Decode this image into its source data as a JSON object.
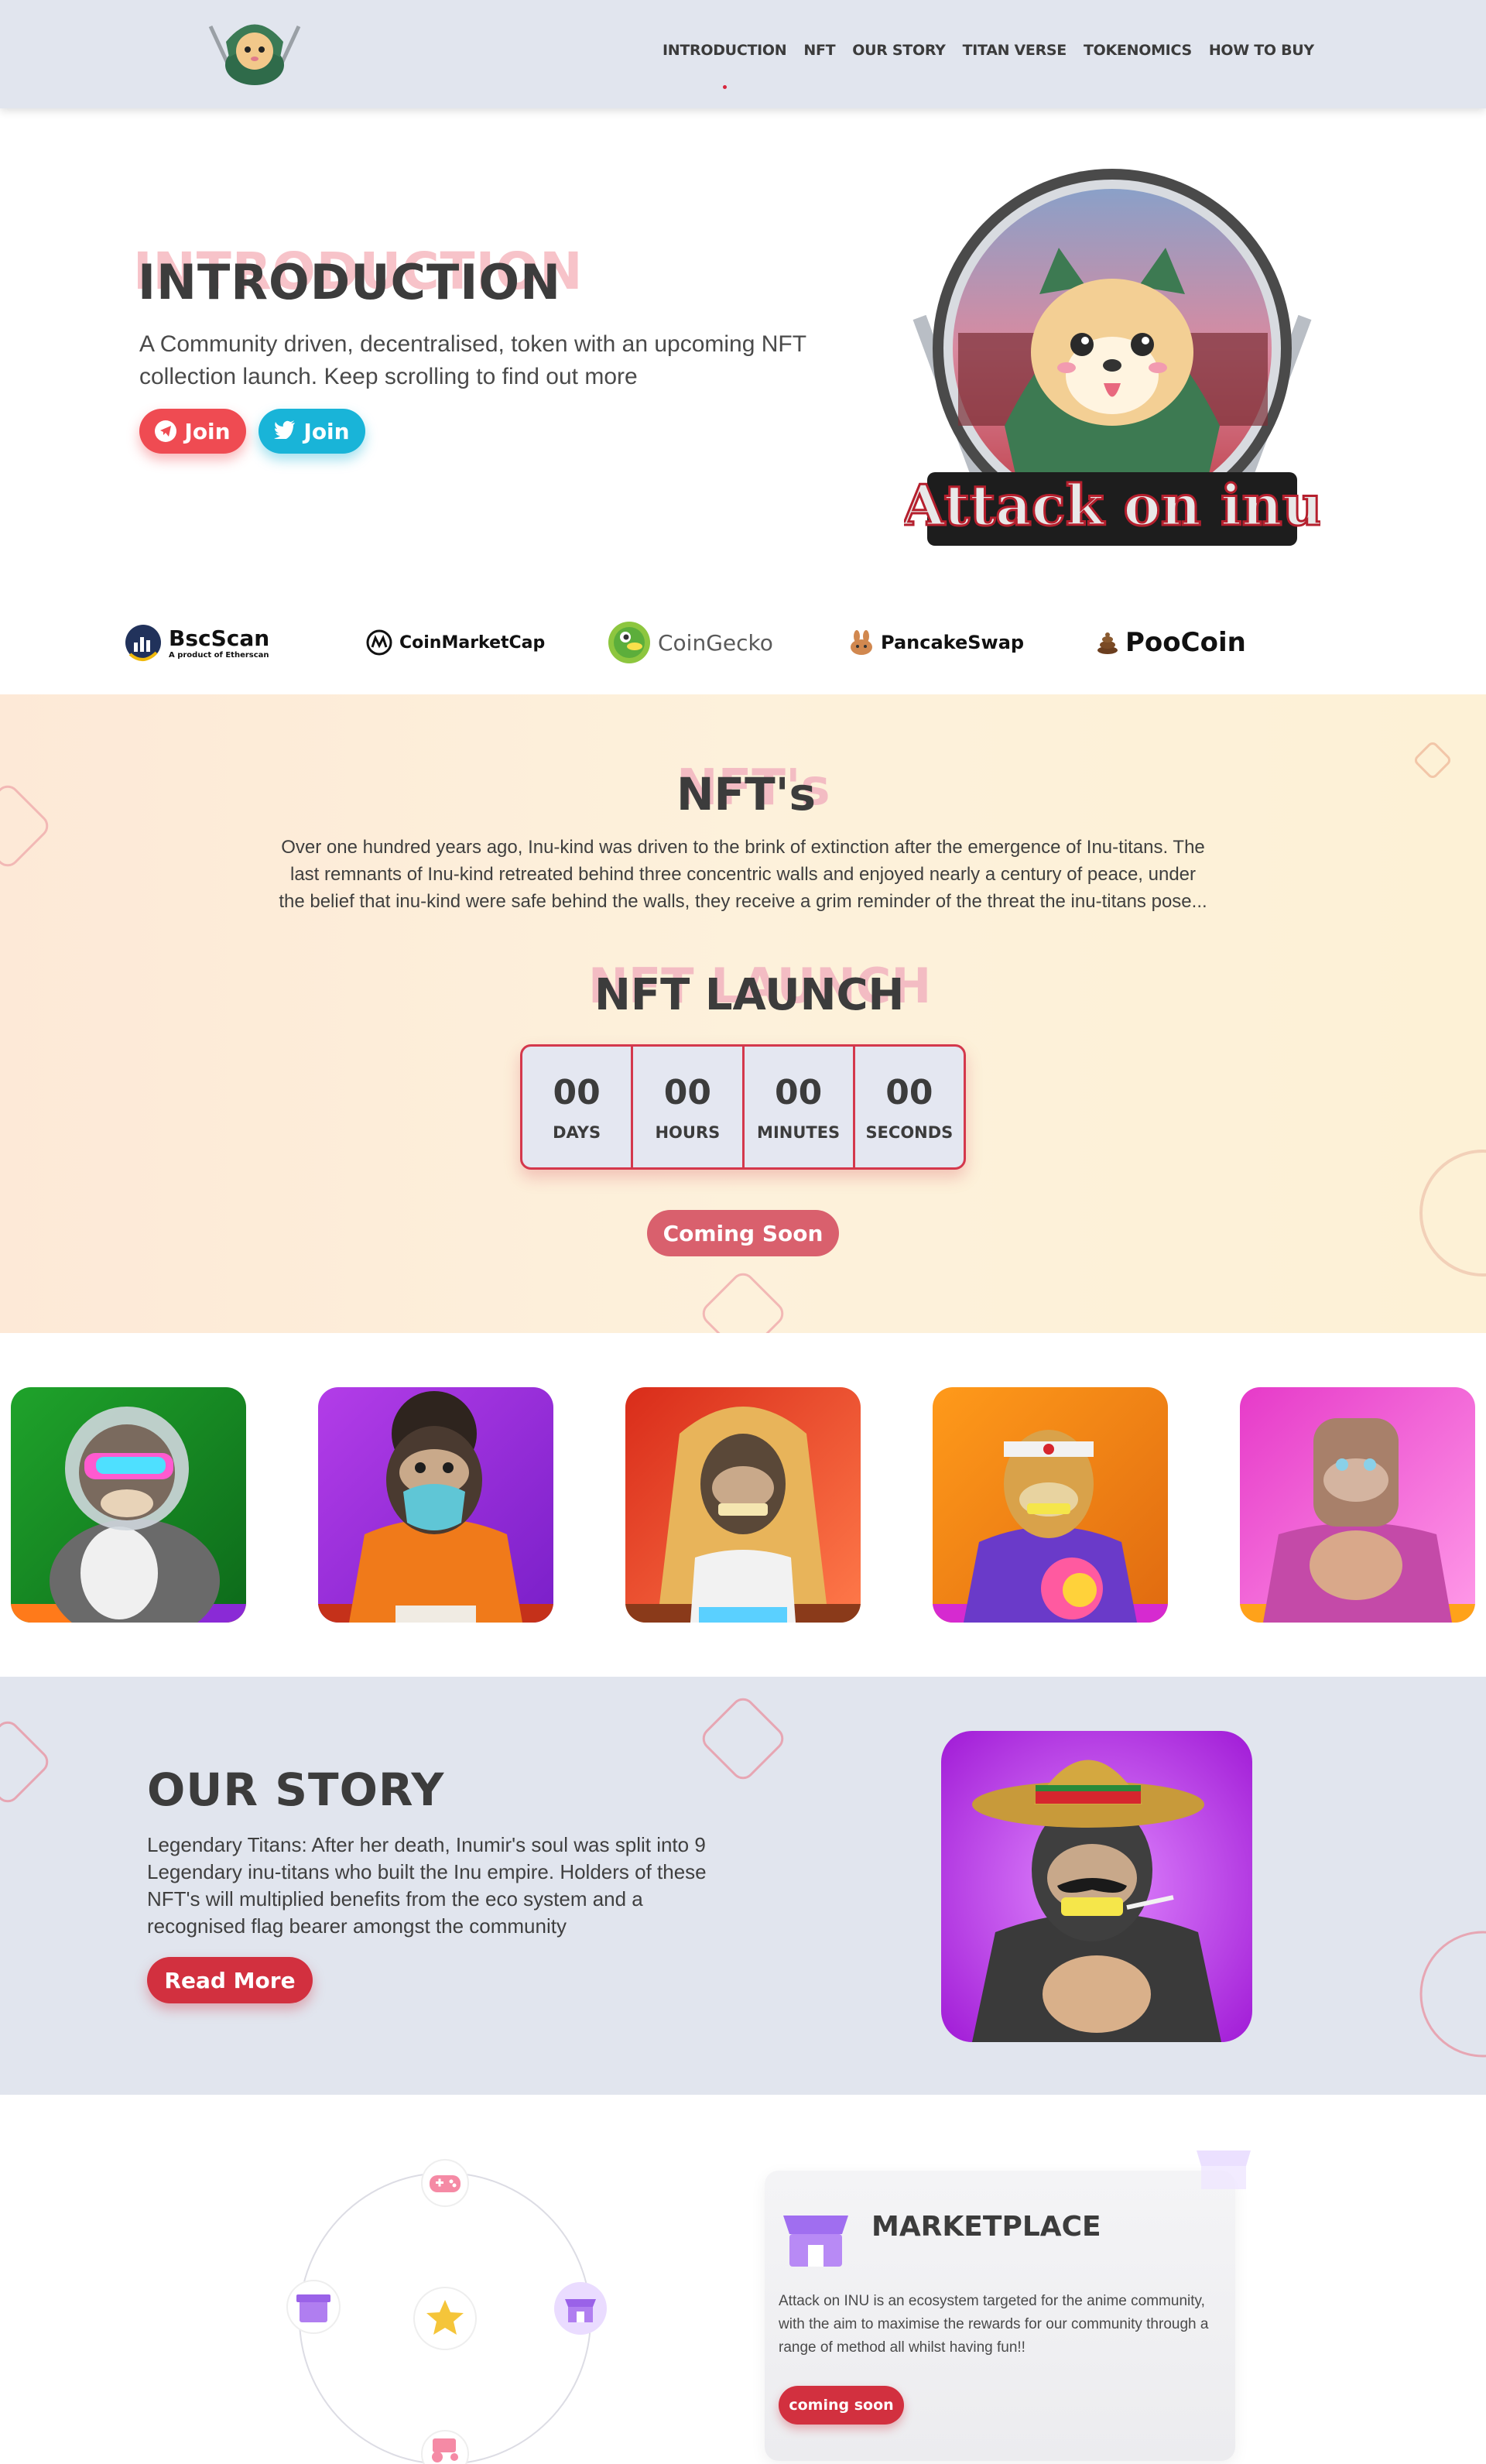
{
  "nav": {
    "links": [
      "INTRODUCTION",
      "NFT",
      "OUR STORY",
      "TITAN VERSE",
      "TOKENOMICS",
      "HOW TO BUY"
    ]
  },
  "intro": {
    "title": "INTRODUCTION",
    "text": "A Community driven, decentralised, token with an upcoming NFT collection launch. Keep scrolling to find out more",
    "join_telegram": "Join",
    "join_twitter": "Join",
    "logo_text": "Attack on inu"
  },
  "partners": {
    "bscscan": "BscScan",
    "bscscan_sub": "A product of Etherscan",
    "coinmarketcap": "CoinMarketCap",
    "coingecko": "CoinGecko",
    "pancakeswap": "PancakeSwap",
    "poocoin": "PooCoin"
  },
  "nft": {
    "title": "NFT's",
    "text": "Over one hundred years ago, Inu-kind was driven to the brink of extinction after the emergence of Inu-titans. The last remnants of Inu-kind retreated behind three concentric walls and enjoyed nearly a century of peace, under the belief that inu-kind were safe behind the walls, they receive a grim reminder of the threat the inu-titans pose...",
    "launch_title": "NFT LAUNCH",
    "countdown": [
      {
        "value": "00",
        "label": "DAYS"
      },
      {
        "value": "00",
        "label": "HOURS"
      },
      {
        "value": "00",
        "label": "MINUTES"
      },
      {
        "value": "00",
        "label": "SECONDS"
      }
    ],
    "coming_soon": "Coming Soon"
  },
  "story": {
    "title": "OUR STORY",
    "text": "Legendary Titans: After her death, Inumir's soul was split into 9 Legendary inu-titans who built the Inu empire. Holders of these NFT's will multiplied benefits from the eco system and a recognised flag bearer amongst the community",
    "read_more": "Read More"
  },
  "marketplace": {
    "title": "MARKETPLACE",
    "text": "Attack on INU is an ecosystem targeted for the anime community, with the aim to maximise the rewards for our community through a range of method all whilst having fun!!",
    "button": "coming soon"
  },
  "colors": {
    "accent_red": "#d2303f",
    "telegram_red": "#ef4b52",
    "twitter_blue": "#19b4d8",
    "nav_bg": "#e1e5ee",
    "ghost_pink": "#f3bcc3"
  }
}
